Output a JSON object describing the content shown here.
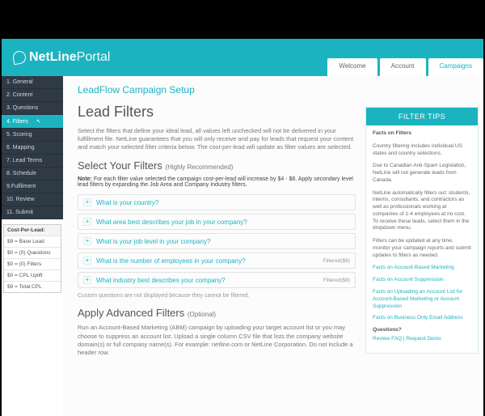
{
  "header": {
    "brand_bold": "NetLine",
    "brand_light": "Portal",
    "tabs": [
      {
        "label": "Welcome"
      },
      {
        "label": "Account"
      },
      {
        "label": "Campaigns"
      }
    ],
    "active_tab_index": 2
  },
  "sidebar": {
    "steps": [
      "1. General",
      "2. Content",
      "3. Questions",
      "4. Filters",
      "5. Scoring",
      "6. Mapping",
      "7. Lead Terms",
      "8. Schedule",
      "9.Fulfilment",
      "10. Review",
      "11. Submit"
    ],
    "active_step_index": 3,
    "cpl": {
      "title": "Cost-Per-Lead:",
      "rows": [
        "$9 = Base Lead",
        "$0 = (0) Questions",
        "$0 = (0) Filters",
        "$0 = CPL Uplift",
        "$9 = Total CPL"
      ]
    }
  },
  "main": {
    "crumb": "LeadFlow Campaign Setup",
    "h1": "Lead Filters",
    "intro": "Select the filters that define your ideal lead, all values left unchecked will not be delivered in your fulfillment file. NetLine guarantees that you will only receive and pay for leads that request your content and match your selected filter criteria below. The cost-per-lead will update as filter values are selected.",
    "select_title": "Select Your Filters",
    "select_sub": "(Highly Recommended)",
    "note_label": "Note:",
    "note_text": " For each filter value selected the campaign cost-per-lead will increase by $4 - $8. Apply secondary level lead filters by expanding the Job Area and Company Industry filters.",
    "filters": [
      {
        "label": "What is your country?",
        "meta": ""
      },
      {
        "label": "What area best describes your job in your company?",
        "meta": ""
      },
      {
        "label": "What is your job level in your company?",
        "meta": ""
      },
      {
        "label": "What is the number of employees in your company?",
        "meta": "Filtered($8)"
      },
      {
        "label": "What industry best describes your company?",
        "meta": "Filtered($8)"
      }
    ],
    "custom_note": "Custom questions are not displayed because they cannot be filtered.",
    "advanced_title": "Apply Advanced Filters",
    "advanced_sub": "(Optional)",
    "advanced_desc": "Run an Account-Based Marketing (ABM) campaign by uploading your target account list or you may choose to suppress an account list. Upload a single column CSV file that lists the company website domain(s) or full company name(s). For example: netline.com or NetLine Corporation. Do not include a header row."
  },
  "tips": {
    "title": "FILTER TIPS",
    "facts_title": "Facts on Filters",
    "p1": "Country filtering includes individual US states and country selections.",
    "p2": "Due to Canadian Anti-Spam Legislation, NetLine will not generate leads from Canada.",
    "p3": "NetLine automatically filters out: students, interns, consultants, and contractors as well as professionals working at companies of 1-4 employees at no cost. To receive these leads, select them in the dropdown menu.",
    "p4": "Filters can be updated at any time, monitor your campaign reports and submit updates to filters as needed.",
    "links": [
      "Facts on Account-Based Marketing",
      "Facts on Account Suppression",
      "Facts on Uploading an Account List for Account-Based Marketing or Account Suppression",
      "Facts on Business Only Email Address"
    ],
    "questions_title": "Questions?",
    "questions_link": "Review FAQ | Request Demo"
  }
}
